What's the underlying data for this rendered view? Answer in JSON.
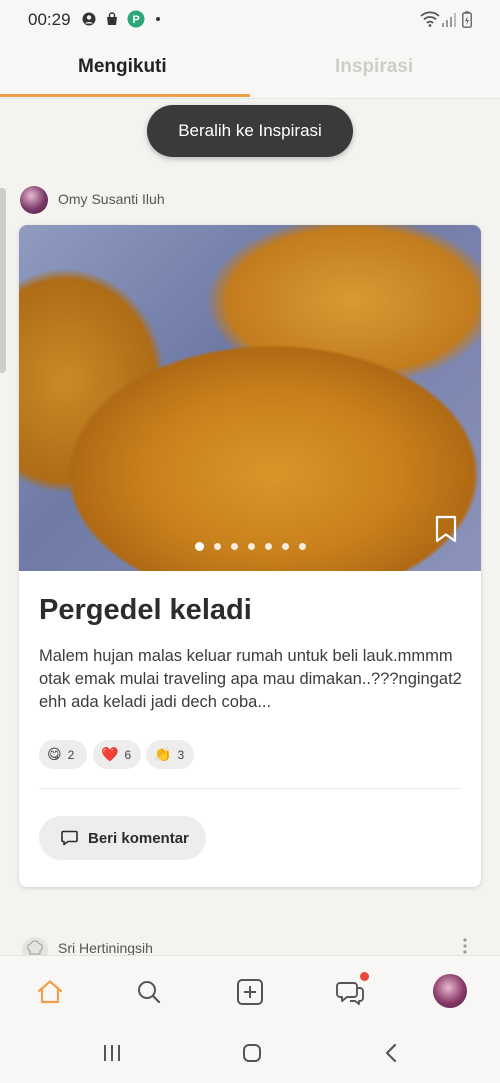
{
  "status_bar": {
    "time": "00:29"
  },
  "tabs": [
    {
      "label": "Mengikuti",
      "active": true
    },
    {
      "label": "Inspirasi",
      "active": false
    }
  ],
  "switch_pill": {
    "label": "Beralih ke Inspirasi"
  },
  "post": {
    "author": "Omy Susanti Iluh",
    "title": "Pergedel keladi",
    "description": "Malem hujan malas keluar rumah untuk beli lauk.mmmm otak emak mulai traveling apa mau dimakan..???ngingat2 ehh ada keladi jadi dech coba...",
    "photo_count": 7,
    "photo_active_index": 0,
    "reactions": [
      {
        "icon": "yum-face-icon",
        "emoji": "😋",
        "count": "2"
      },
      {
        "icon": "heart-icon",
        "emoji": "❤️",
        "count": "6"
      },
      {
        "icon": "clap-icon",
        "emoji": "👏",
        "count": "3"
      }
    ],
    "comment_button": "Beri komentar"
  },
  "next_post": {
    "author": "Sri Hertiningsih"
  },
  "bottom_nav": [
    {
      "icon": "home-icon",
      "active": true
    },
    {
      "icon": "search-icon",
      "active": false
    },
    {
      "icon": "add-recipe-icon",
      "active": false
    },
    {
      "icon": "chat-icon",
      "active": false,
      "badge": true
    },
    {
      "icon": "profile-avatar",
      "active": false
    }
  ],
  "colors": {
    "accent": "#f0a04a",
    "notification": "#e84a3a",
    "pill_bg": "#3a3a3a"
  }
}
